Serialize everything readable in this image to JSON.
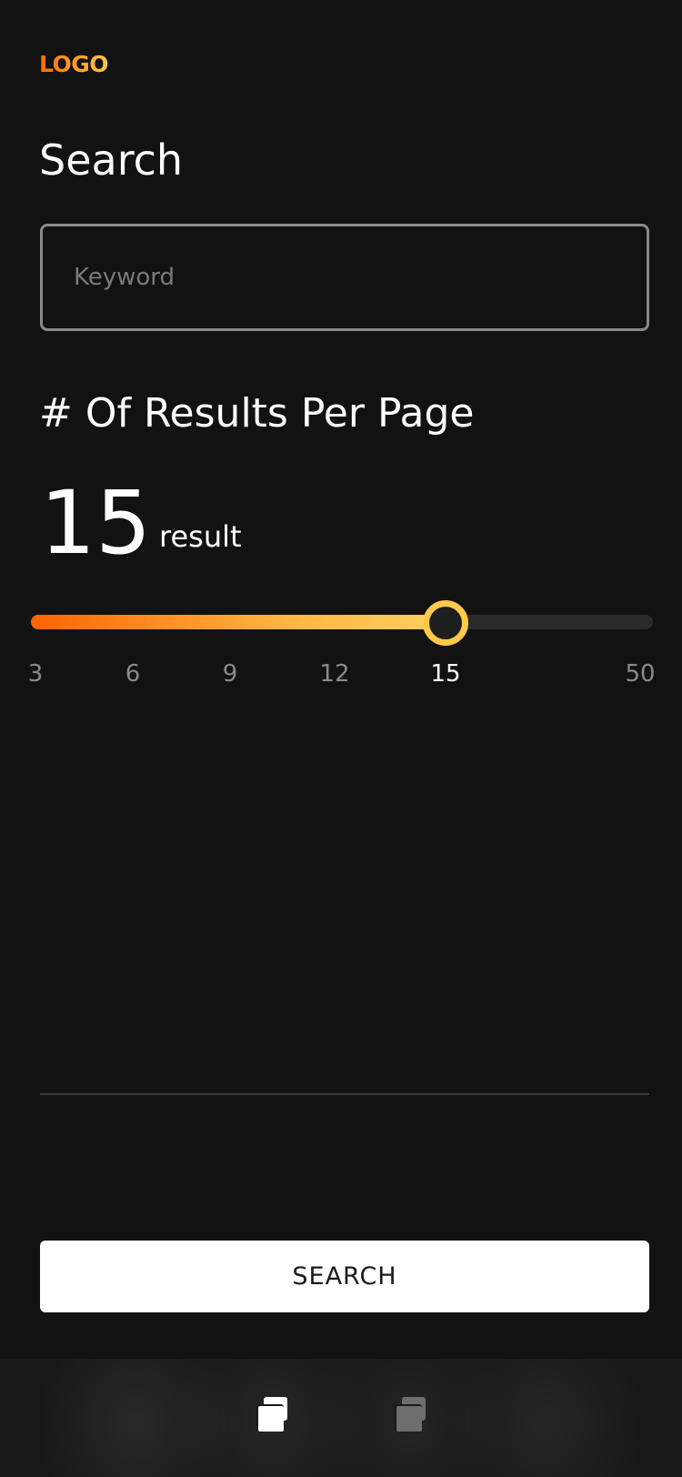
{
  "header": {
    "logo_text": "LOGO"
  },
  "search": {
    "title": "Search",
    "placeholder": "Keyword",
    "value": ""
  },
  "results_per_page": {
    "title": "# Of Results Per Page",
    "value": "15",
    "unit": "result",
    "slider_fraction": 0.667,
    "ticks": [
      "3",
      "6",
      "9",
      "12",
      "15",
      "50"
    ],
    "active_tick": "15"
  },
  "actions": {
    "search_label": "SEARCH"
  },
  "bottom_nav": {
    "items": [
      {
        "icon": "stacked-squares-icon",
        "state": "active",
        "color": "#ffffff"
      },
      {
        "icon": "stacked-squares-icon",
        "state": "inactive",
        "color": "#6e6e6e"
      }
    ]
  },
  "colors": {
    "accent_start": "#ff6400",
    "accent_end": "#ffc94a",
    "background": "#121212"
  }
}
